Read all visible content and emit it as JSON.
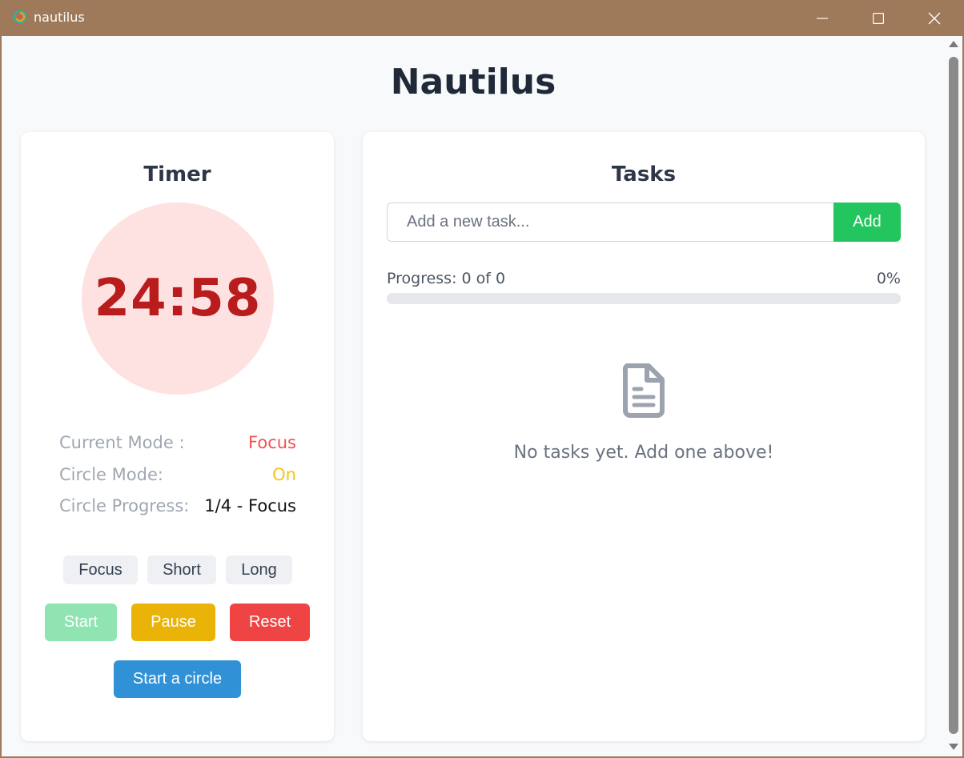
{
  "window": {
    "title": "nautilus",
    "app_icon": "nautilus-logo-icon",
    "controls": {
      "minimize_icon": "minimize-icon",
      "maximize_icon": "maximize-icon",
      "close_icon": "close-icon"
    }
  },
  "header": {
    "title": "Nautilus"
  },
  "timer": {
    "heading": "Timer",
    "time": "24:58",
    "info": {
      "current_mode_label": "Current Mode :",
      "current_mode_value": "Focus",
      "circle_mode_label": "Circle Mode:",
      "circle_mode_value": "On",
      "circle_progress_label": "Circle Progress:",
      "circle_progress_value": "1/4 - Focus"
    },
    "mode_buttons": {
      "focus": "Focus",
      "short": "Short",
      "long": "Long"
    },
    "actions": {
      "start": "Start",
      "pause": "Pause",
      "reset": "Reset",
      "start_circle": "Start a circle"
    }
  },
  "tasks": {
    "heading": "Tasks",
    "input": {
      "value": "",
      "placeholder": "Add a new task..."
    },
    "add_label": "Add",
    "progress": {
      "label": "Progress: 0 of 0",
      "percent_label": "0%",
      "percent": 0
    },
    "empty_state": {
      "icon": "document-icon",
      "message": "No tasks yet. Add one above!"
    }
  },
  "colors": {
    "titlebar": "#9e795a",
    "timer_text": "#b91c1c",
    "timer_circle": "#fee2e2",
    "mode_focus": "#ef5350",
    "circle_on": "#f6c31a",
    "start_disabled": "#8fe4b1",
    "pause": "#eab308",
    "reset": "#ef4444",
    "start_circle": "#3091d6",
    "add": "#22c55e",
    "progress_fill": "#22c55e",
    "progress_track": "#e5e7eb"
  }
}
